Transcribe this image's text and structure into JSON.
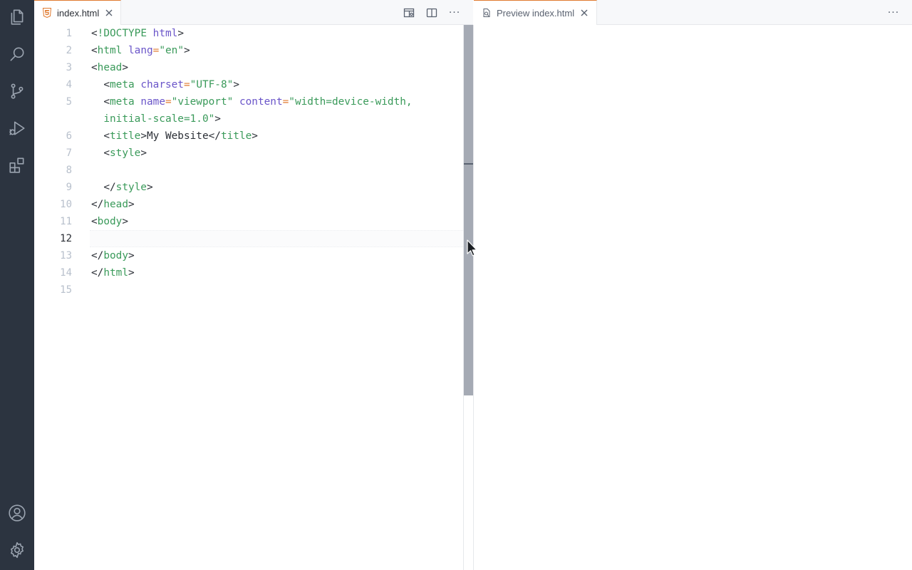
{
  "activity_bar": {
    "items": [
      {
        "icon": "files-icon"
      },
      {
        "icon": "search-icon"
      },
      {
        "icon": "source-control-icon"
      },
      {
        "icon": "run-debug-icon"
      },
      {
        "icon": "extensions-icon"
      }
    ],
    "bottom": [
      {
        "icon": "account-icon"
      },
      {
        "icon": "settings-gear-icon"
      }
    ]
  },
  "left_group": {
    "tab_label": "index.html",
    "more_label": "···"
  },
  "right_group": {
    "tab_label": "Preview index.html",
    "more_label": "···"
  },
  "editor": {
    "current_line": 12,
    "line_numbers": [
      "1",
      "2",
      "3",
      "4",
      "5",
      "6",
      "7",
      "8",
      "9",
      "10",
      "11",
      "12",
      "13",
      "14",
      "15"
    ],
    "lines": [
      [
        [
          "p",
          "<"
        ],
        [
          "kw",
          "!DOCTYPE"
        ],
        [
          "p",
          " "
        ],
        [
          "attr",
          "html"
        ],
        [
          "p",
          ">"
        ]
      ],
      [
        [
          "p",
          "<"
        ],
        [
          "tag",
          "html"
        ],
        [
          "p",
          " "
        ],
        [
          "attr",
          "lang"
        ],
        [
          "eq",
          "="
        ],
        [
          "str",
          "\"en\""
        ],
        [
          "p",
          ">"
        ]
      ],
      [
        [
          "p",
          "<"
        ],
        [
          "tag",
          "head"
        ],
        [
          "p",
          ">"
        ]
      ],
      [
        [
          "p",
          "  <"
        ],
        [
          "tag",
          "meta"
        ],
        [
          "p",
          " "
        ],
        [
          "attr",
          "charset"
        ],
        [
          "eq",
          "="
        ],
        [
          "str",
          "\"UTF-8\""
        ],
        [
          "p",
          ">"
        ]
      ],
      [
        [
          "p",
          "  <"
        ],
        [
          "tag",
          "meta"
        ],
        [
          "p",
          " "
        ],
        [
          "attr",
          "name"
        ],
        [
          "eq",
          "="
        ],
        [
          "str",
          "\"viewport\""
        ],
        [
          "p",
          " "
        ],
        [
          "attr",
          "content"
        ],
        [
          "eq",
          "="
        ],
        [
          "str",
          "\"width=device-width,"
        ]
      ],
      [
        [
          "str",
          "  initial-scale=1.0\""
        ],
        [
          "p",
          ">"
        ]
      ],
      [
        [
          "p",
          "  <"
        ],
        [
          "tag",
          "title"
        ],
        [
          "p",
          ">My Website</"
        ],
        [
          "tag",
          "title"
        ],
        [
          "p",
          ">"
        ]
      ],
      [
        [
          "p",
          "  <"
        ],
        [
          "tag",
          "style"
        ],
        [
          "p",
          ">"
        ]
      ],
      [
        [
          "p",
          ""
        ]
      ],
      [
        [
          "p",
          "  </"
        ],
        [
          "tag",
          "style"
        ],
        [
          "p",
          ">"
        ]
      ],
      [
        [
          "p",
          "</"
        ],
        [
          "tag",
          "head"
        ],
        [
          "p",
          ">"
        ]
      ],
      [
        [
          "p",
          "<"
        ],
        [
          "tag",
          "body"
        ],
        [
          "p",
          ">"
        ]
      ],
      [
        [
          "p",
          ""
        ]
      ],
      [
        [
          "p",
          "</"
        ],
        [
          "tag",
          "body"
        ],
        [
          "p",
          ">"
        ]
      ],
      [
        [
          "p",
          "</"
        ],
        [
          "tag",
          "html"
        ],
        [
          "p",
          ">"
        ]
      ],
      [
        [
          "p",
          ""
        ]
      ]
    ]
  },
  "colors": {
    "activity_bg": "#2c3440",
    "accent": "#e07a2f",
    "tag": "#3a9a5a",
    "attr": "#6a55c9"
  }
}
